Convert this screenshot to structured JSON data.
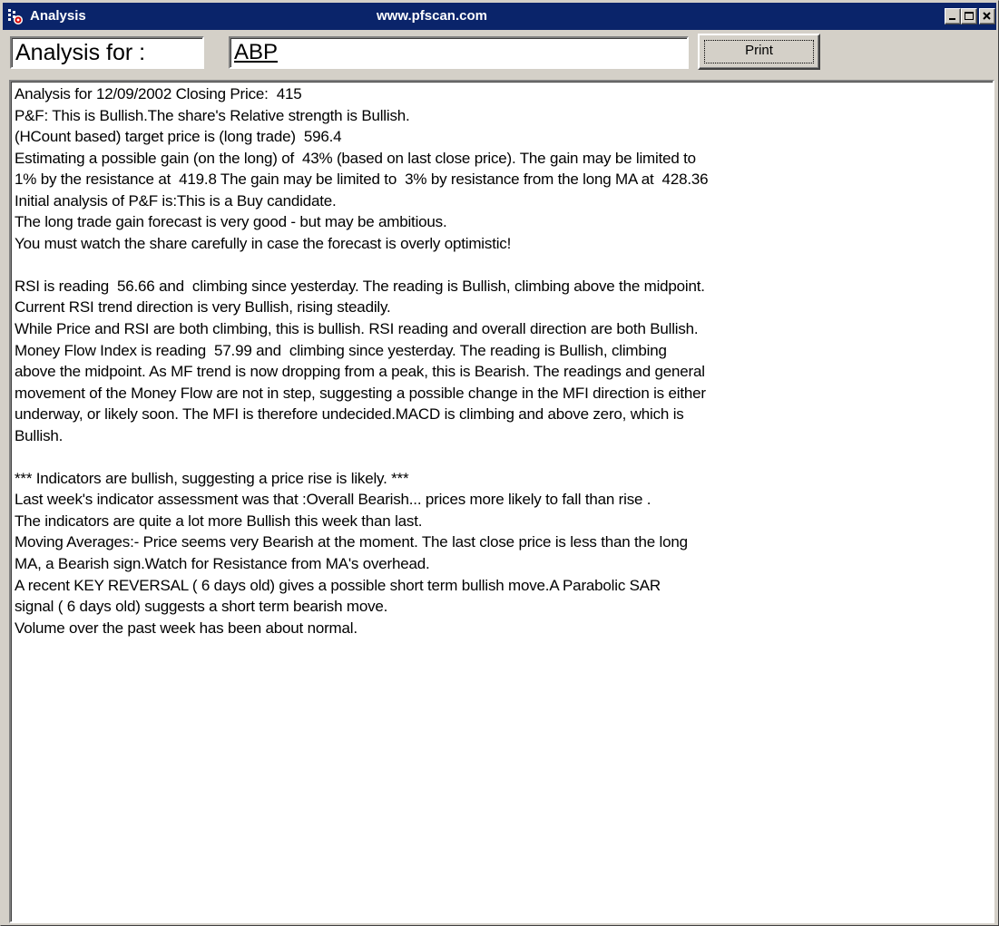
{
  "window": {
    "title": "Analysis",
    "subtitle": "www.pfscan.com"
  },
  "header": {
    "label": "Analysis for :",
    "symbol": "ABP",
    "print_label": "Print"
  },
  "analysis": {
    "lines": [
      "Analysis for 12/09/2002 Closing Price:  415",
      "P&F: This is Bullish.The share's Relative strength is Bullish.",
      "(HCount based) target price is (long trade)  596.4",
      "Estimating a possible gain (on the long) of  43% (based on last close price). The gain may be limited to",
      "1% by the resistance at  419.8 The gain may be limited to  3% by resistance from the long MA at  428.36",
      "Initial analysis of P&F is:This is a Buy candidate.",
      "The long trade gain forecast is very good - but may be ambitious.",
      "You must watch the share carefully in case the forecast is overly optimistic!",
      "",
      "RSI is reading  56.66 and  climbing since yesterday. The reading is Bullish, climbing above the midpoint.",
      "Current RSI trend direction is very Bullish, rising steadily.",
      "While Price and RSI are both climbing, this is bullish. RSI reading and overall direction are both Bullish.",
      "Money Flow Index is reading  57.99 and  climbing since yesterday. The reading is Bullish, climbing",
      "above the midpoint. As MF trend is now dropping from a peak, this is Bearish. The readings and general",
      "movement of the Money Flow are not in step, suggesting a possible change in the MFI direction is either",
      "underway, or likely soon. The MFI is therefore undecided.MACD is climbing and above zero, which is",
      "Bullish.",
      "",
      "*** Indicators are bullish, suggesting a price rise is likely. ***",
      "Last week's indicator assessment was that :Overall Bearish... prices more likely to fall than rise .",
      "The indicators are quite a lot more Bullish this week than last.",
      "Moving Averages:- Price seems very Bearish at the moment. The last close price is less than the long",
      "MA, a Bearish sign.Watch for Resistance from MA's overhead.",
      "A recent KEY REVERSAL ( 6 days old) gives a possible short term bullish move.A Parabolic SAR",
      "signal ( 6 days old) suggests a short term bearish move.",
      "Volume over the past week has been about normal."
    ]
  }
}
